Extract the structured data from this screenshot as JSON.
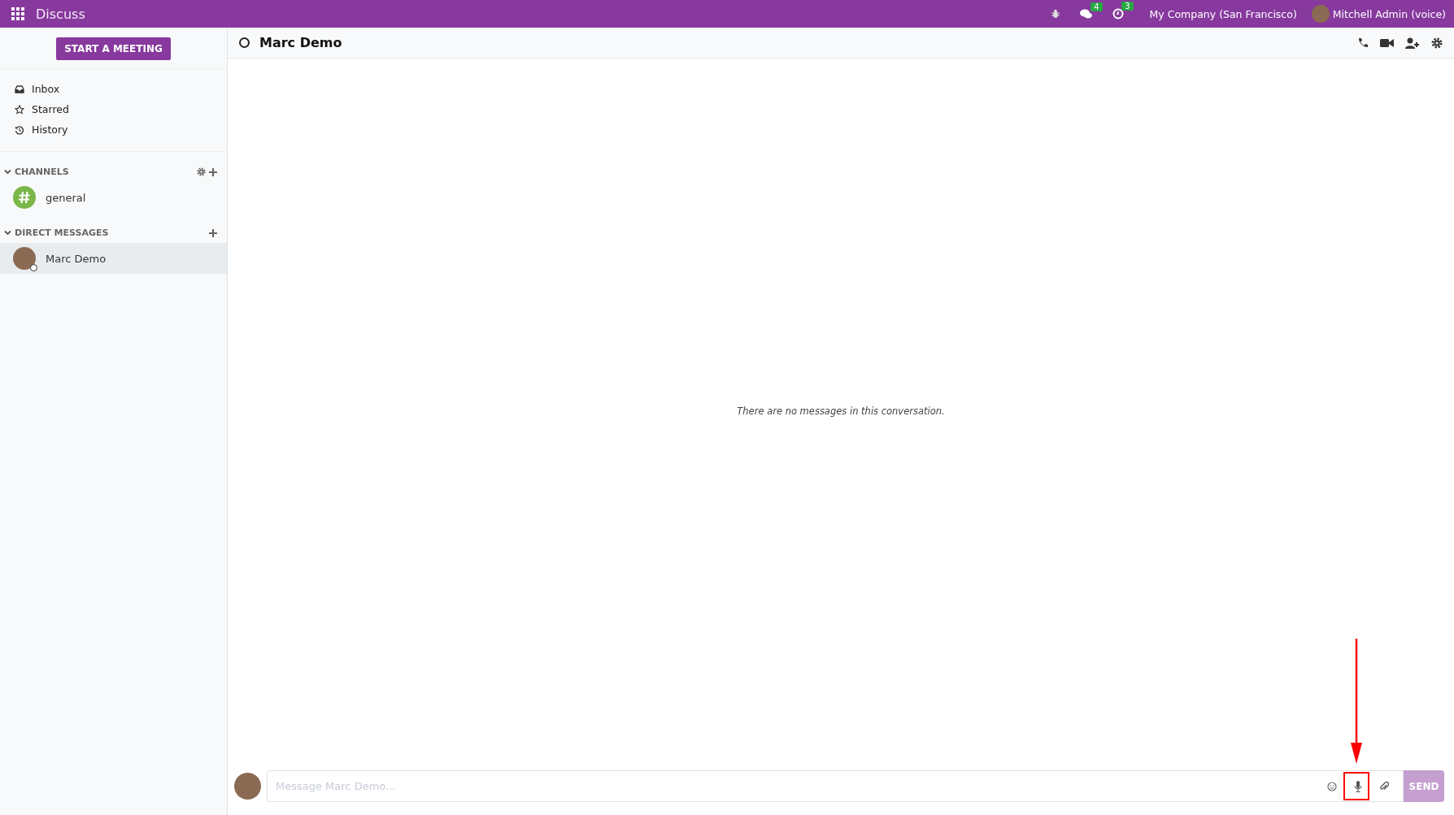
{
  "top_bar": {
    "app_title": "Discuss",
    "message_badge": "4",
    "activity_badge": "3",
    "company": "My Company (San Francisco)",
    "user": "Mitchell Admin (voice)"
  },
  "sidebar": {
    "start_meeting": "START A MEETING",
    "mailboxes": [
      {
        "kind": "inbox",
        "label": "Inbox",
        "selected": false
      },
      {
        "kind": "starred",
        "label": "Starred",
        "selected": false
      },
      {
        "kind": "history",
        "label": "History",
        "selected": false
      }
    ],
    "sections": [
      {
        "title": "CHANNELS",
        "expanded": true,
        "settings": true,
        "items": [
          {
            "kind": "channel",
            "name": "general",
            "selected": false
          }
        ]
      },
      {
        "title": "DIRECT MESSAGES",
        "expanded": true,
        "settings": false,
        "items": [
          {
            "kind": "person",
            "name": "Marc Demo",
            "selected": true
          }
        ]
      }
    ]
  },
  "conversation": {
    "title": "Marc Demo",
    "empty_text": "There are no messages in this conversation."
  },
  "composer": {
    "placeholder": "Message Marc Demo...",
    "send": "SEND"
  },
  "annotations": [
    {
      "kind": "arrow-box"
    }
  ]
}
